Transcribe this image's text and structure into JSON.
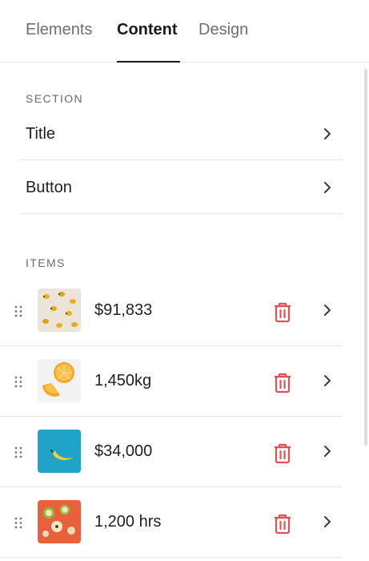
{
  "tabs": [
    {
      "label": "Elements",
      "active": false
    },
    {
      "label": "Content",
      "active": true
    },
    {
      "label": "Design",
      "active": false
    }
  ],
  "section": {
    "heading": "SECTION",
    "rows": [
      {
        "label": "Title"
      },
      {
        "label": "Button"
      }
    ]
  },
  "items": {
    "heading": "ITEMS",
    "list": [
      {
        "value": "$91,833",
        "thumb_icon": "lemons-image"
      },
      {
        "value": "1,450kg",
        "thumb_icon": "orange-slices-image"
      },
      {
        "value": "$34,000",
        "thumb_icon": "banana-image"
      },
      {
        "value": "1,200 hrs",
        "thumb_icon": "apple-pieces-image"
      }
    ]
  },
  "icons": {
    "chevron": "chevron-right-icon",
    "trash": "trash-icon",
    "drag": "drag-handle-icon"
  },
  "colors": {
    "accent_text": "#1a1a1a",
    "muted_text": "#6e6e6e",
    "trash_red": "#e05252",
    "divider": "#e4e4e4"
  }
}
